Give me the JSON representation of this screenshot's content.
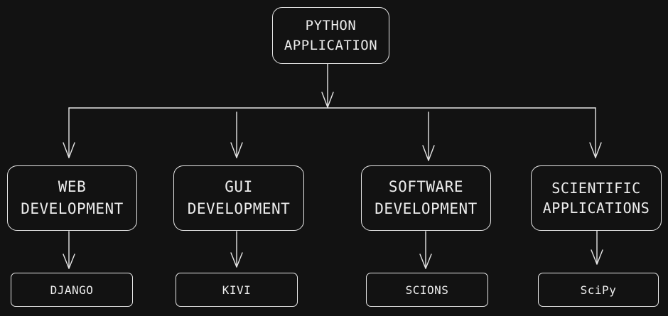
{
  "root": {
    "lines": [
      "PYTHON",
      "APPLICATION"
    ]
  },
  "categories": [
    {
      "lines": [
        "WEB",
        "DEVELOPMENT"
      ],
      "leaf": "DJANGO"
    },
    {
      "lines": [
        "GUI",
        "DEVELOPMENT"
      ],
      "leaf": "KIVI"
    },
    {
      "lines": [
        "SOFTWARE",
        "DEVELOPMENT"
      ],
      "leaf": "SCIONS"
    },
    {
      "lines": [
        "SCIENTIFIC",
        "APPLICATIONS"
      ],
      "leaf": "SciPy"
    }
  ],
  "colors": {
    "background": "#121212",
    "stroke": "#e8e8e8",
    "text": "#ececec"
  }
}
